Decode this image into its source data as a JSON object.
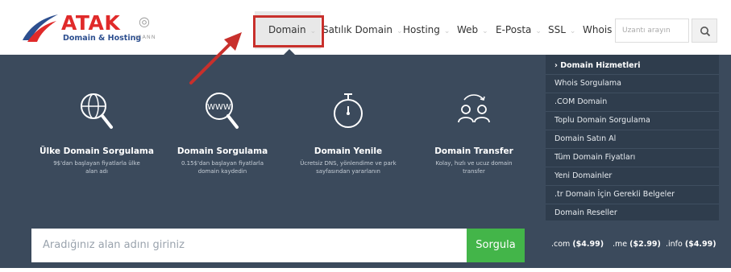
{
  "logo": {
    "name": "ATAK",
    "subtitle": "Domain & Hosting",
    "icann": "ICANN",
    "colors": {
      "red": "#e02a2a",
      "blue": "#2d4f8f"
    }
  },
  "nav": {
    "items": [
      {
        "label": "Domain",
        "caret": "⌄"
      },
      {
        "label": "Satılık Domain",
        "caret": "⌄"
      },
      {
        "label": "Hosting",
        "caret": "⌄"
      },
      {
        "label": "Web",
        "caret": "⌄"
      },
      {
        "label": "E-Posta",
        "caret": "⌄"
      },
      {
        "label": "SSL",
        "caret": "⌄"
      },
      {
        "label": "Whois"
      }
    ],
    "search_placeholder": "Uzantı arayın"
  },
  "features": [
    {
      "title": "Ülke Domain Sorgulama",
      "desc": "9$'dan başlayan fiyatlarla ülke alan adı",
      "icon": "globe-search-icon"
    },
    {
      "title": "Domain Sorgulama",
      "desc": "0.15$'dan başlayan fiyatlarla domain kaydedin",
      "icon": "www-search-icon"
    },
    {
      "title": "Domain Yenile",
      "desc": "Ücretsiz DNS, yönlendime ve park sayfasından yararlanın",
      "icon": "stopwatch-icon"
    },
    {
      "title": "Domain Transfer",
      "desc": "Kolay, hızlı ve ucuz domain transfer",
      "icon": "users-transfer-icon"
    }
  ],
  "dropdown": {
    "header": "Domain Hizmetleri",
    "header_arrow": "›",
    "items": [
      "Whois Sorgulama",
      ".COM Domain",
      "Toplu Domain Sorgulama",
      "Domain Satın Al",
      "Tüm Domain Fiyatları",
      "Yeni Domainler",
      ".tr Domain İçin Gerekli Belgeler",
      "Domain Reseller"
    ]
  },
  "domain_search": {
    "placeholder": "Aradığınız alan adını giriniz",
    "button": "Sorgula"
  },
  "prices": [
    {
      "tld": ".com",
      "price": "($4.99)"
    },
    {
      "tld": ".me",
      "price": "($2.99)"
    },
    {
      "tld": ".info",
      "price": "($4.99)"
    }
  ],
  "annotation": {
    "highlight_color": "#c8302c",
    "arrow_color": "#c8302c"
  },
  "colors": {
    "dark_bg": "#3b4a5c",
    "dropdown_bg": "#2f3d4d",
    "button_green": "#43b549"
  }
}
